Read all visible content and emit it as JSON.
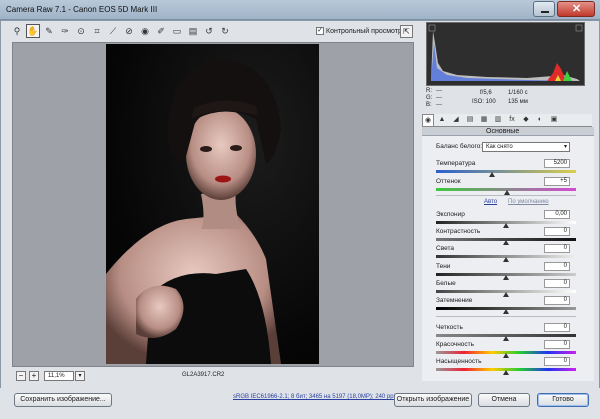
{
  "window": {
    "title": "Camera Raw 7.1  -  Canon EOS 5D Mark III",
    "min_glyph": "—",
    "close_glyph": "✕"
  },
  "toolbar": {
    "tools": [
      "zoom-icon",
      "hand-icon",
      "white-balance-icon",
      "color-sampler-icon",
      "targeted-adjustment-icon",
      "crop-icon",
      "straighten-icon",
      "spot-removal-icon",
      "red-eye-icon",
      "adjustment-brush-icon",
      "graduated-filter-icon",
      "preferences-icon",
      "rotate-ccw-icon",
      "rotate-cw-icon"
    ],
    "glyphs": [
      "⚲",
      "✋",
      "✎",
      "✑",
      "⊙",
      "⌗",
      "⟋",
      "⊘",
      "◉",
      "✐",
      "▭",
      "▤",
      "↺",
      "↻"
    ],
    "preview_label": "Контрольный просмотр",
    "preview_check": "✓",
    "fullscreen_glyph": "⇱"
  },
  "preview": {
    "zoom_out": "−",
    "zoom_in": "+",
    "zoom_value": "11,1%",
    "zoom_dropdown": "▾",
    "filename": "GL2A3917.CR2"
  },
  "info": {
    "r_label": "R:",
    "r_value": "---",
    "g_label": "G:",
    "g_value": "---",
    "b_label": "B:",
    "b_value": "---",
    "aperture": "f/5,6",
    "shutter": "1/160 с",
    "iso": "ISO: 100",
    "focal": "135 мм"
  },
  "panel": {
    "tabs": [
      "◉",
      "▲",
      "◢",
      "▤",
      "▦",
      "▥",
      "fx",
      "◆",
      "◐",
      "▣"
    ],
    "title": "Основные",
    "wb_label": "Баланс белого:",
    "wb_value": "Как снято",
    "wb_arrow": "▾",
    "auto_link": "Авто",
    "default_link": "По умолчанию",
    "sliders": [
      {
        "name": "temperature",
        "label": "Температура",
        "value": "5200",
        "pos": 0.4,
        "track": "linear-gradient(90deg,#2b5fcf,#d9cf4a)"
      },
      {
        "name": "tint",
        "label": "Оттенок",
        "value": "+5",
        "pos": 0.51,
        "track": "linear-gradient(90deg,#3ec93e,#d44ad4)"
      },
      {
        "name": "exposure",
        "label": "Экспонир",
        "value": "0,00",
        "pos": 0.5,
        "track": "linear-gradient(90deg,#222,#fff)"
      },
      {
        "name": "contrast",
        "label": "Контрастность",
        "value": "0",
        "pos": 0.5,
        "track": "linear-gradient(90deg,#777,#111)"
      },
      {
        "name": "highlights",
        "label": "Света",
        "value": "0",
        "pos": 0.5,
        "track": "linear-gradient(90deg,#333,#eee)"
      },
      {
        "name": "shadows",
        "label": "Тени",
        "value": "0",
        "pos": 0.5,
        "track": "linear-gradient(90deg,#222,#ccc)"
      },
      {
        "name": "whites",
        "label": "Белые",
        "value": "0",
        "pos": 0.5,
        "track": "linear-gradient(90deg,#444,#fff)"
      },
      {
        "name": "blacks",
        "label": "Затемнение",
        "value": "0",
        "pos": 0.5,
        "track": "linear-gradient(90deg,#000,#999)"
      },
      {
        "name": "clarity",
        "label": "Четкость",
        "value": "0",
        "pos": 0.5,
        "track": "linear-gradient(90deg,#888,#333)"
      },
      {
        "name": "vibrance",
        "label": "Красочность",
        "value": "0",
        "pos": 0.5,
        "track": "linear-gradient(90deg,#999,#e23,#fc0,#2c3,#23e,#c2e)"
      },
      {
        "name": "saturation",
        "label": "Насыщенность",
        "value": "0",
        "pos": 0.5,
        "track": "linear-gradient(90deg,#999,#e23,#fc0,#2c3,#23e,#c2e)"
      }
    ]
  },
  "bottom": {
    "save_label": "Сохранить изображение...",
    "workflow_link": "sRGB IEC61966-2.1; 8 бит; 3465 на 5197 (18,0МР); 240 ppi",
    "open_label": "Открыть изображение",
    "cancel_label": "Отмена",
    "done_label": "Готово"
  }
}
